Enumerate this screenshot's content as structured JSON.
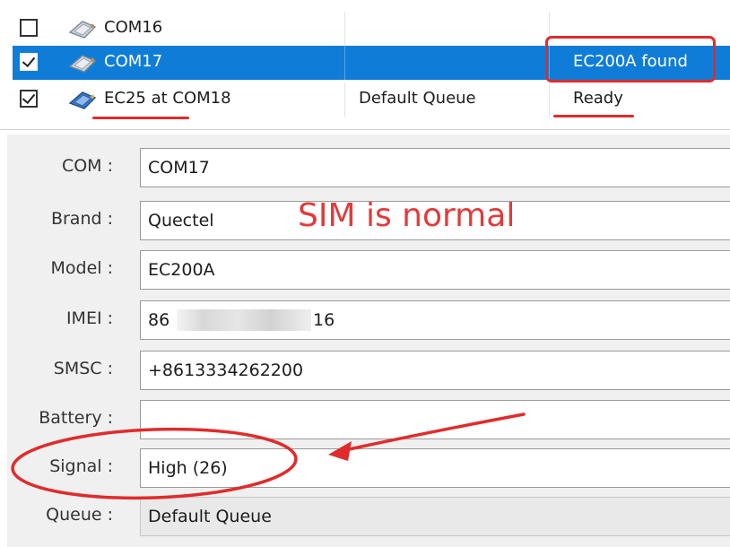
{
  "device_list": {
    "rows": [
      {
        "checked": false,
        "name": "COM16",
        "queue": "",
        "status": "",
        "selected": false
      },
      {
        "checked": true,
        "name": "COM17",
        "queue": "",
        "status": "EC200A found",
        "selected": true
      },
      {
        "checked": true,
        "name": "EC25 at COM18",
        "queue": "Default Queue",
        "status": "Ready",
        "selected": false
      }
    ]
  },
  "details": {
    "com": {
      "label": "COM :",
      "value": "COM17"
    },
    "brand": {
      "label": "Brand :",
      "value": "Quectel"
    },
    "model": {
      "label": "Model :",
      "value": "EC200A"
    },
    "imei": {
      "label": "IMEI :",
      "value_start": "86",
      "value_end": "16"
    },
    "smsc": {
      "label": "SMSC :",
      "value": "+8613334262200"
    },
    "battery": {
      "label": "Battery :",
      "value": ""
    },
    "signal": {
      "label": "Signal :",
      "value": "High (26)"
    },
    "queue": {
      "label": "Queue :",
      "value": "Default Queue"
    }
  },
  "annotations": {
    "sim_note": "SIM is normal",
    "annotation_color": "#e12b2b"
  },
  "colors": {
    "selected_row": "#0f7dd8",
    "panel_bg": "#f0f0f0"
  }
}
